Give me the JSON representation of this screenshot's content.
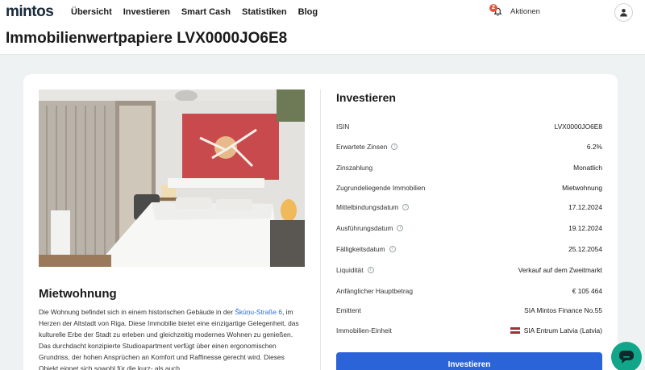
{
  "brand": {
    "logo": "mintos"
  },
  "nav": {
    "items": [
      {
        "label": "Übersicht"
      },
      {
        "label": "Investieren"
      },
      {
        "label": "Smart Cash"
      },
      {
        "label": "Statistiken"
      },
      {
        "label": "Blog"
      }
    ]
  },
  "header": {
    "notification_count": "2",
    "actions_label": "Aktionen"
  },
  "page": {
    "title": "Immobilienwertpapiere LVX0000JO6E8"
  },
  "property": {
    "title": "Mietwohnung",
    "description_before_link": "Die Wohnung befindet sich in einem historischen Gebäude in der ",
    "description_link": "Škūņu-Straße 6",
    "description_after_link": ", im Herzen der Altstadt von Riga. Diese Immobilie bietet eine einzigartige Gelegenheit, das kulturelle Erbe der Stadt zu erleben und gleichzeitig modernes Wohnen zu genießen. Das durchdacht konzipierte Studioapartment verfügt über einen ergonomischen Grundriss, der hohen Ansprüchen an Komfort und Raffinesse gerecht wird. Dieses Objekt eignet sich sowohl für die kurz- als auch"
  },
  "invest": {
    "title": "Investieren",
    "button_label": "Investieren",
    "rows": [
      {
        "label": "ISIN",
        "value": "LVX0000JO6E8"
      },
      {
        "label": "Erwartete Zinsen",
        "value": "6.2%"
      },
      {
        "label": "Zinszahlung",
        "value": "Monatlich"
      },
      {
        "label": "Zugrundeliegende Immobilien",
        "value": "Mietwohnung"
      },
      {
        "label": "Mittelbindungsdatum",
        "value": "17.12.2024"
      },
      {
        "label": "Ausführungsdatum",
        "value": "19.12.2024"
      },
      {
        "label": "Fälligkeitsdatum",
        "value": "25.12.2054"
      },
      {
        "label": "Liquidität",
        "value": "Verkauf auf dem Zweitmarkt"
      },
      {
        "label": "Anfänglicher Hauptbetrag",
        "value": "€ 105 464"
      },
      {
        "label": "Emittent",
        "value": "SIA Mintos Finance No.55"
      },
      {
        "label": "Immobilien-Einheit",
        "value": "SIA Entrum Latvia (Latvia)"
      }
    ]
  },
  "colors": {
    "accent": "#2b63d9",
    "chat": "#11a58a",
    "badge": "#e3563c"
  }
}
